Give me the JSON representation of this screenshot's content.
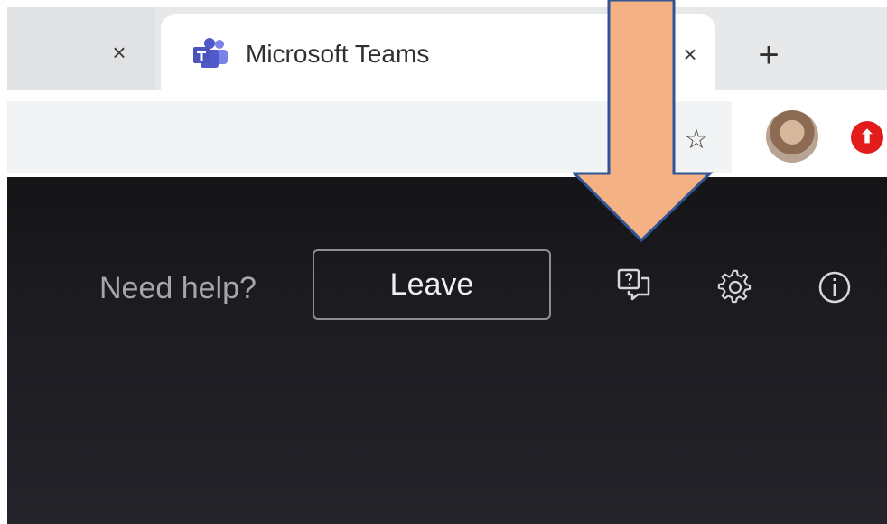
{
  "browser": {
    "tabs": [
      {
        "title": "",
        "close_glyph": "×"
      },
      {
        "title": "Microsoft Teams",
        "icon": "teams-logo-icon",
        "close_glyph": "×"
      }
    ],
    "new_tab_glyph": "+",
    "toolbar_icons": [
      "extensions-icon",
      "bookmark-star-icon",
      "profile-avatar",
      "red-extension-icon"
    ],
    "star_glyph": "☆"
  },
  "meeting": {
    "help_text": "Need help?",
    "leave_label": "Leave",
    "controls": [
      "help-chat-icon",
      "settings-gear-icon",
      "info-icon"
    ]
  },
  "annotation": {
    "arrow_fill": "#f4b183",
    "arrow_stroke": "#2f5597",
    "points_to": "help-chat-icon"
  },
  "colors": {
    "meeting_bg": "#1b1b20",
    "leave_border": "#8e8e92",
    "help_text": "#a6a6aa",
    "tab_bg": "#e7e8ea"
  }
}
